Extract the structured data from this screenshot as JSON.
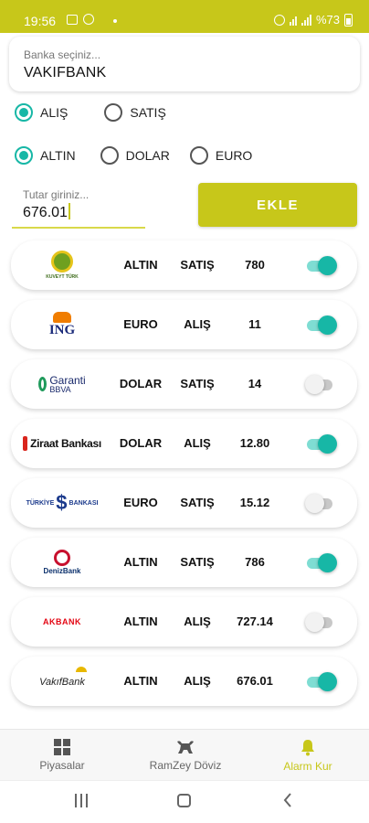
{
  "status_bar": {
    "time": "19:56",
    "battery": "%73"
  },
  "bank_select": {
    "placeholder": "Banka seçiniz...",
    "value": "VAKIFBANK"
  },
  "trade_type": {
    "options": [
      "ALIŞ",
      "SATIŞ"
    ],
    "selected": "ALIŞ"
  },
  "currency": {
    "options": [
      "ALTIN",
      "DOLAR",
      "EURO"
    ],
    "selected": "ALTIN"
  },
  "amount": {
    "placeholder": "Tutar giriniz...",
    "value": "676.01"
  },
  "add_button": "EKLE",
  "alarms": [
    {
      "bank": "Kuveyt Türk",
      "logo_text": "KUVEYT TÜRK",
      "currency": "ALTIN",
      "type": "SATIŞ",
      "amount": "780",
      "enabled": true
    },
    {
      "bank": "ING",
      "logo_text": "ING",
      "currency": "EURO",
      "type": "ALIŞ",
      "amount": "11",
      "enabled": true
    },
    {
      "bank": "Garanti BBVA",
      "logo_text": "Garanti",
      "logo_text2": "BBVA",
      "currency": "DOLAR",
      "type": "SATIŞ",
      "amount": "14",
      "enabled": false
    },
    {
      "bank": "Ziraat Bankası",
      "logo_text": "Ziraat Bankası",
      "currency": "DOLAR",
      "type": "ALIŞ",
      "amount": "12.80",
      "enabled": true
    },
    {
      "bank": "Türkiye İş Bankası",
      "logo_text": "TÜRKİYE",
      "logo_text2": "BANKASI",
      "currency": "EURO",
      "type": "SATIŞ",
      "amount": "15.12",
      "enabled": false
    },
    {
      "bank": "DenizBank",
      "logo_text": "DenizBank",
      "currency": "ALTIN",
      "type": "SATIŞ",
      "amount": "786",
      "enabled": true
    },
    {
      "bank": "Akbank",
      "logo_text": "AKBANK",
      "currency": "ALTIN",
      "type": "ALIŞ",
      "amount": "727.14",
      "enabled": false
    },
    {
      "bank": "VakıfBank",
      "logo_text": "VakıfBank",
      "currency": "ALTIN",
      "type": "ALIŞ",
      "amount": "676.01",
      "enabled": true
    }
  ],
  "bottom_nav": [
    {
      "label": "Piyasalar",
      "icon": "dashboard-icon",
      "active": false
    },
    {
      "label": "RamZey Döviz",
      "icon": "bull-icon",
      "active": false
    },
    {
      "label": "Alarm Kur",
      "icon": "bell-icon",
      "active": true
    }
  ],
  "colors": {
    "accent": "#c7c71a",
    "toggle_on": "#17b7a6",
    "radio_on": "#17b7a6"
  }
}
